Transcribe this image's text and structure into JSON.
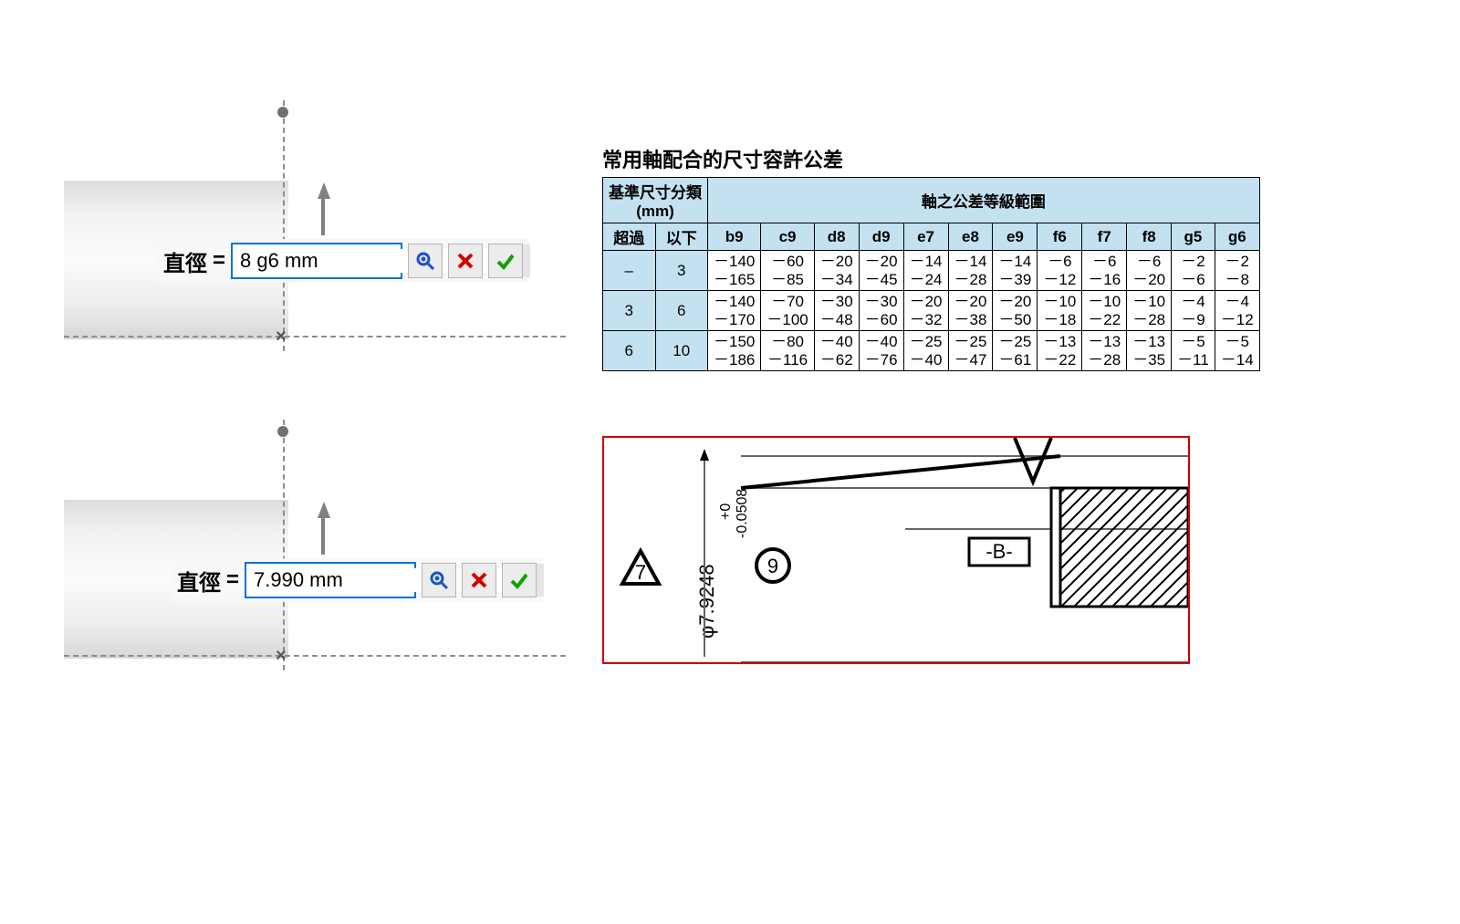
{
  "tolerance_table": {
    "title": "常用軸配合的尺寸容許公差",
    "range_header": [
      "基準尺寸分類",
      "(mm)"
    ],
    "range_subheader": [
      "超過",
      "以下"
    ],
    "grade_header": "軸之公差等級範圍",
    "grades": [
      "b9",
      "c9",
      "d8",
      "d9",
      "e7",
      "e8",
      "e9",
      "f6",
      "f7",
      "f8",
      "g5",
      "g6"
    ],
    "rows": [
      {
        "over": "–",
        "to": "3",
        "vals": [
          [
            "－140",
            "－165"
          ],
          [
            "－60",
            "－85"
          ],
          [
            "－20",
            "－34"
          ],
          [
            "－20",
            "－45"
          ],
          [
            "－14",
            "－24"
          ],
          [
            "－14",
            "－28"
          ],
          [
            "－14",
            "－39"
          ],
          [
            "－6",
            "－12"
          ],
          [
            "－6",
            "－16"
          ],
          [
            "－6",
            "－20"
          ],
          [
            "－2",
            "－6"
          ],
          [
            "－2",
            "－8"
          ]
        ]
      },
      {
        "over": "3",
        "to": "6",
        "vals": [
          [
            "－140",
            "－170"
          ],
          [
            "－70",
            "－100"
          ],
          [
            "－30",
            "－48"
          ],
          [
            "－30",
            "－60"
          ],
          [
            "－20",
            "－32"
          ],
          [
            "－20",
            "－38"
          ],
          [
            "－20",
            "－50"
          ],
          [
            "－10",
            "－18"
          ],
          [
            "－10",
            "－22"
          ],
          [
            "－10",
            "－28"
          ],
          [
            "－4",
            "－9"
          ],
          [
            "－4",
            "－12"
          ]
        ]
      },
      {
        "over": "6",
        "to": "10",
        "vals": [
          [
            "－150",
            "－186"
          ],
          [
            "－80",
            "－116"
          ],
          [
            "－40",
            "－62"
          ],
          [
            "－40",
            "－76"
          ],
          [
            "－25",
            "－40"
          ],
          [
            "－25",
            "－47"
          ],
          [
            "－25",
            "－61"
          ],
          [
            "－13",
            "－22"
          ],
          [
            "－13",
            "－28"
          ],
          [
            "－13",
            "－35"
          ],
          [
            "－5",
            "－11"
          ],
          [
            "－5",
            "－14"
          ]
        ]
      }
    ]
  },
  "inputs": [
    {
      "label": "直徑",
      "equals": "=",
      "value": "8 g6 mm"
    },
    {
      "label": "直徑",
      "equals": "=",
      "value": "7.990 mm"
    }
  ],
  "drawing": {
    "diameter": "φ7.9248",
    "upper_tol": "+0",
    "lower_tol": "-0.0508",
    "balloon1": "7",
    "balloon2": "9",
    "datum": "-B-"
  },
  "chart_data": {
    "type": "table",
    "title": "常用軸配合的尺寸容許公差 (Shaft fit tolerance table, μm, negative deviations)",
    "columns": [
      "over_mm",
      "to_mm",
      "b9_upper",
      "b9_lower",
      "c9_upper",
      "c9_lower",
      "d8_upper",
      "d8_lower",
      "d9_upper",
      "d9_lower",
      "e7_upper",
      "e7_lower",
      "e8_upper",
      "e8_lower",
      "e9_upper",
      "e9_lower",
      "f6_upper",
      "f6_lower",
      "f7_upper",
      "f7_lower",
      "f8_upper",
      "f8_lower",
      "g5_upper",
      "g5_lower",
      "g6_upper",
      "g6_lower"
    ],
    "rows": [
      [
        null,
        3,
        -140,
        -165,
        -60,
        -85,
        -20,
        -34,
        -20,
        -45,
        -14,
        -24,
        -14,
        -28,
        -14,
        -39,
        -6,
        -12,
        -6,
        -16,
        -6,
        -20,
        -2,
        -6,
        -2,
        -8
      ],
      [
        3,
        6,
        -140,
        -170,
        -70,
        -100,
        -30,
        -48,
        -30,
        -60,
        -20,
        -32,
        -20,
        -38,
        -20,
        -50,
        -10,
        -18,
        -10,
        -22,
        -10,
        -28,
        -4,
        -9,
        -4,
        -12
      ],
      [
        6,
        10,
        -150,
        -186,
        -80,
        -116,
        -40,
        -62,
        -40,
        -76,
        -25,
        -40,
        -25,
        -47,
        -25,
        -61,
        -13,
        -22,
        -13,
        -28,
        -13,
        -35,
        -5,
        -11,
        -5,
        -14
      ]
    ]
  }
}
